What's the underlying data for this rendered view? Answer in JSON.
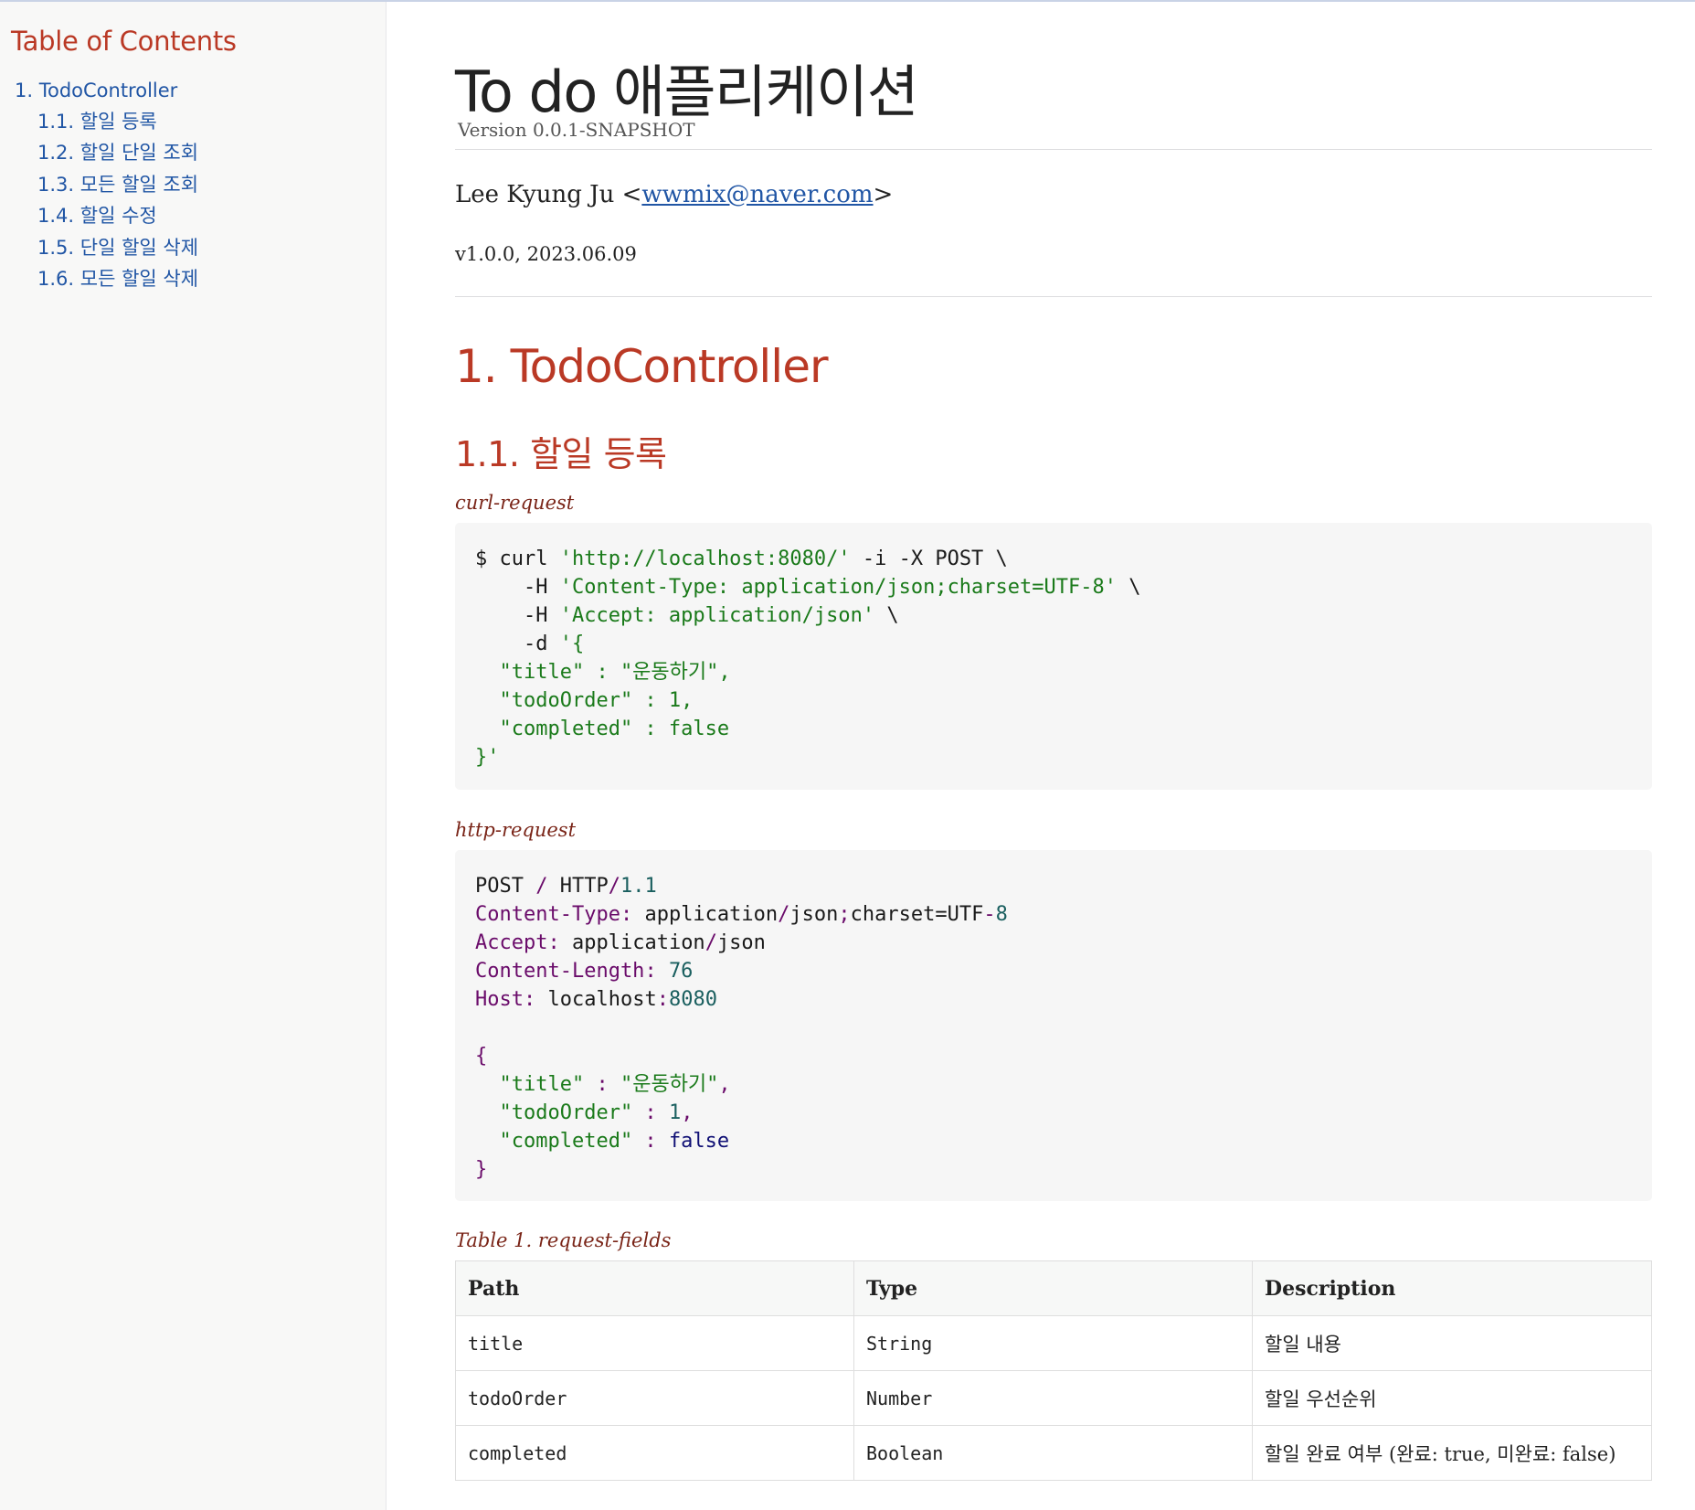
{
  "toc": {
    "title": "Table of Contents",
    "items": [
      {
        "label": "1. TodoController",
        "children": [
          {
            "label": "1.1. 할일 등록"
          },
          {
            "label": "1.2. 할일 단일 조회"
          },
          {
            "label": "1.3. 모든 할일 조회"
          },
          {
            "label": "1.4. 할일 수정"
          },
          {
            "label": "1.5. 단일 할일 삭제"
          },
          {
            "label": "1.6. 모든 할일 삭제"
          }
        ]
      }
    ]
  },
  "header": {
    "title": "To do 애플리케이션",
    "version": "Version 0.0.1-SNAPSHOT",
    "author_name": "Lee Kyung Ju <",
    "author_email": "wwmix@naver.com",
    "author_suffix": ">",
    "revision": "v1.0.0, 2023.06.09"
  },
  "section": {
    "title": "1. TodoController",
    "subsection_title": "1.1. 할일 등록",
    "curl_title": "curl-request",
    "http_title": "http-request",
    "table_title": "Table 1. request-fields"
  },
  "curl": {
    "prompt": "$ curl ",
    "url": "'http://localhost:8080/'",
    "flags": " -i -X POST \\",
    "h1_flag": "    -H ",
    "h1_val": "'Content-Type: application/json;charset=UTF-8'",
    "h1_end": " \\",
    "h2_flag": "    -H ",
    "h2_val": "'Accept: application/json'",
    "h2_end": " \\",
    "d_flag": "    -d ",
    "d_open": "'{",
    "title_line": "  \"title\" : \"운동하기\",",
    "order_line": "  \"todoOrder\" : 1,",
    "completed_line": "  \"completed\" : false",
    "close": "}'"
  },
  "http": {
    "method": "POST",
    "slash": " / ",
    "proto": "HTTP",
    "proto_slash": "/",
    "proto_ver": "1.1",
    "ct_name": "Content-Type",
    "ct_colon": ": ",
    "ct_value_a": "application",
    "ct_value_slash": "/",
    "ct_value_b": "json",
    "ct_semi": ";",
    "ct_value_c": "charset=UTF",
    "ct_dash": "-",
    "ct_value_d": "8",
    "accept_name": "Accept",
    "accept_colon": ": ",
    "accept_a": "application",
    "accept_slash": "/",
    "accept_b": "json",
    "cl_name": "Content-Length",
    "cl_colon": ": ",
    "cl_value": "76",
    "host_name": "Host",
    "host_colon": ": ",
    "host_value": "localhost",
    "host_port_colon": ":",
    "host_port": "8080",
    "open": "{",
    "title_key": "  \"title\"",
    "title_sep": " : ",
    "title_val": "\"운동하기\"",
    "title_comma": ",",
    "order_key": "  \"todoOrder\"",
    "order_sep": " : ",
    "order_val": "1",
    "order_comma": ",",
    "completed_key": "  \"completed\"",
    "completed_sep": " : ",
    "completed_val": "false",
    "close": "}"
  },
  "table": {
    "headers": [
      "Path",
      "Type",
      "Description"
    ],
    "rows": [
      [
        "title",
        "String",
        "할일 내용"
      ],
      [
        "todoOrder",
        "Number",
        "할일 우선순위"
      ],
      [
        "completed",
        "Boolean",
        "할일 완료 여부 (완료: true, 미완료: false)"
      ]
    ]
  }
}
